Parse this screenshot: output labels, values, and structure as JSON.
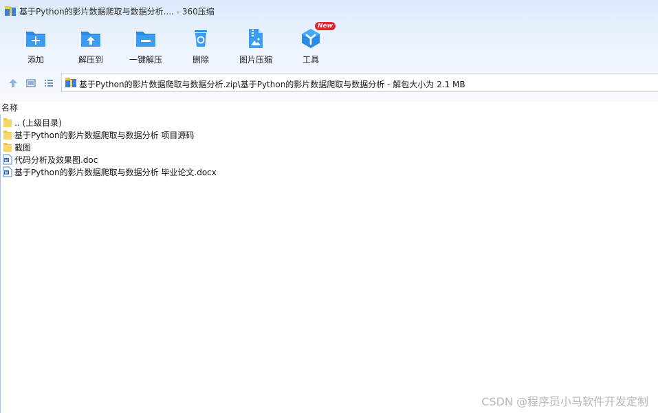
{
  "window": {
    "title": "基于Python的影片数据爬取与数据分析.... - 360压缩"
  },
  "toolbar": {
    "items": [
      {
        "label": "添加",
        "icon": "add-folder-icon"
      },
      {
        "label": "解压到",
        "icon": "extract-to-folder-icon"
      },
      {
        "label": "一键解压",
        "icon": "one-click-extract-icon"
      },
      {
        "label": "删除",
        "icon": "recycle-bin-icon"
      },
      {
        "label": "图片压缩",
        "icon": "image-compress-icon"
      },
      {
        "label": "工具",
        "icon": "tools-cube-icon",
        "badge": "New"
      }
    ]
  },
  "nav": {
    "path": "基于Python的影片数据爬取与数据分析.zip\\基于Python的影片数据爬取与数据分析 - 解包大小为 2.1 MB"
  },
  "list": {
    "column_name": "名称",
    "rows": [
      {
        "name": ".. (上级目录)",
        "type": "folder"
      },
      {
        "name": "基于Python的影片数据爬取与数据分析 项目源码",
        "type": "folder"
      },
      {
        "name": "截图",
        "type": "folder"
      },
      {
        "name": "代码分析及效果图.doc",
        "type": "word"
      },
      {
        "name": "基于Python的影片数据爬取与数据分析 毕业论文.docx",
        "type": "word"
      }
    ]
  },
  "watermark": "CSDN @程序员小马软件开发定制",
  "colors": {
    "accent": "#2a8ae6",
    "badge": "#e0242b",
    "folder": "#f5c542"
  }
}
